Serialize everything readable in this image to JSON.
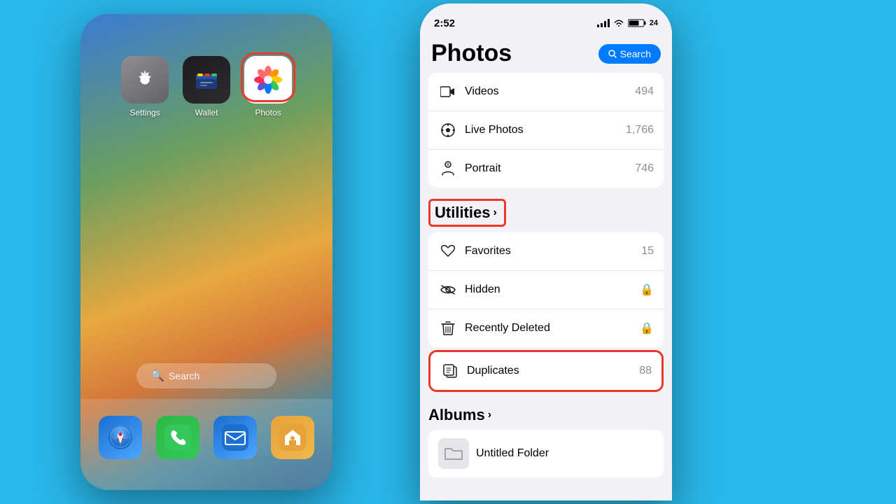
{
  "background_color": "#29b6e8",
  "left_panel": {
    "apps": [
      {
        "id": "settings",
        "label": "Settings"
      },
      {
        "id": "wallet",
        "label": "Wallet"
      },
      {
        "id": "photos",
        "label": "Photos"
      }
    ],
    "dock": [
      {
        "id": "safari",
        "label": "Safari"
      },
      {
        "id": "phone",
        "label": "Phone"
      },
      {
        "id": "mail",
        "label": "Mail"
      },
      {
        "id": "home",
        "label": "Home"
      }
    ],
    "search_label": "Search"
  },
  "right_panel": {
    "status_bar": {
      "time": "2:52",
      "battery": "24"
    },
    "header": {
      "title": "Photos",
      "search_button": "Search"
    },
    "top_item": {
      "icon": "videos",
      "label": "Videos",
      "count": "494"
    },
    "media_types": [
      {
        "id": "live-photos",
        "label": "Live Photos",
        "count": "1,766"
      },
      {
        "id": "portrait",
        "label": "Portrait",
        "count": "746"
      }
    ],
    "utilities_section": {
      "title": "Utilities",
      "items": [
        {
          "id": "favorites",
          "label": "Favorites",
          "count": "15",
          "has_lock": false
        },
        {
          "id": "hidden",
          "label": "Hidden",
          "count": "",
          "has_lock": true
        },
        {
          "id": "recently-deleted",
          "label": "Recently Deleted",
          "count": "",
          "has_lock": true
        },
        {
          "id": "duplicates",
          "label": "Duplicates",
          "count": "88",
          "has_lock": false,
          "highlighted": true
        }
      ]
    },
    "albums_section": {
      "title": "Albums",
      "items": [
        {
          "id": "untitled-folder",
          "label": "Untitled Folder"
        }
      ]
    }
  }
}
